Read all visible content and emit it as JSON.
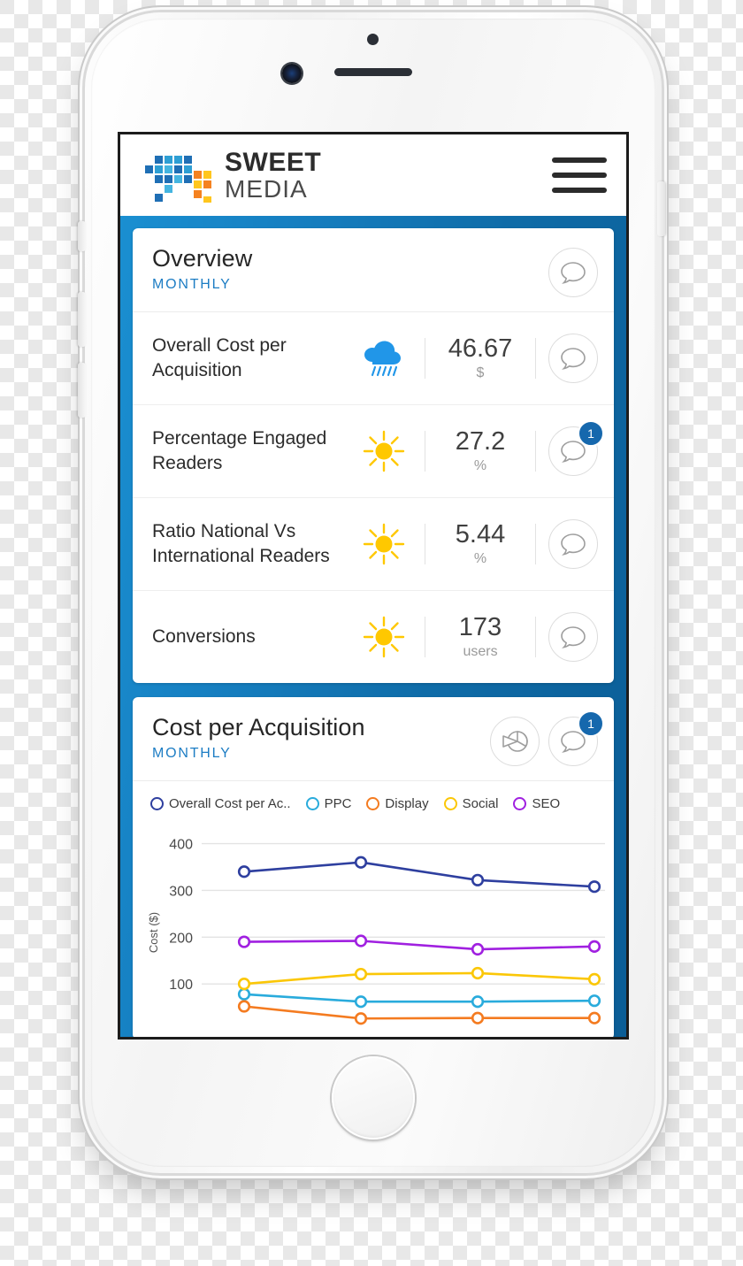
{
  "brand": {
    "name_top": "SWEET",
    "name_bottom": "MEDIA",
    "logo_icon": "pixel-map-logo",
    "menu_icon": "hamburger-menu-icon"
  },
  "overview_card": {
    "title": "Overview",
    "subtitle": "MONTHLY",
    "comment_icon": "speech-bubble-icon",
    "metrics": [
      {
        "label": "Overall Cost per Acquisition",
        "status_icon": "rain-cloud-icon",
        "value": "46.67",
        "unit": "$",
        "comment_icon": "speech-bubble-icon",
        "badge": ""
      },
      {
        "label": "Percentage Engaged Readers",
        "status_icon": "sun-icon",
        "value": "27.2",
        "unit": "%",
        "comment_icon": "speech-bubble-icon",
        "badge": "1"
      },
      {
        "label": "Ratio National Vs International Readers",
        "status_icon": "sun-icon",
        "value": "5.44",
        "unit": "%",
        "comment_icon": "speech-bubble-icon",
        "badge": ""
      },
      {
        "label": "Conversions",
        "status_icon": "sun-icon",
        "value": "173",
        "unit": "users",
        "comment_icon": "speech-bubble-icon",
        "badge": ""
      }
    ]
  },
  "chart_card": {
    "title": "Cost per Acquisition",
    "subtitle": "MONTHLY",
    "drilldown_icon": "pie-arrow-drilldown-icon",
    "comment_icon": "speech-bubble-icon",
    "comment_badge": "1"
  },
  "chart_data": {
    "type": "line",
    "title": "Cost per Acquisition",
    "xlabel": "",
    "ylabel": "Cost ($)",
    "ylim": [
      0,
      420
    ],
    "yticks": [
      100,
      200,
      300,
      400
    ],
    "grid": true,
    "legend_position": "top",
    "x": [
      1,
      2,
      3,
      4
    ],
    "series": [
      {
        "name": "Overall Cost per Ac..",
        "color": "#2E3F9F",
        "values": [
          340,
          360,
          322,
          308
        ]
      },
      {
        "name": "PPC",
        "color": "#29ABDC",
        "values": [
          78,
          62,
          62,
          64
        ]
      },
      {
        "name": "Display",
        "color": "#F47B20",
        "values": [
          52,
          26,
          27,
          27
        ]
      },
      {
        "name": "Social",
        "color": "#FBC707",
        "values": [
          100,
          121,
          123,
          110
        ]
      },
      {
        "name": "SEO",
        "color": "#A020E0",
        "values": [
          190,
          192,
          174,
          180
        ]
      }
    ]
  },
  "colors": {
    "brand_blue": "#1668ad",
    "card_blue_light": "#1a8fd1",
    "card_blue_dark": "#0b5d96",
    "sun_yellow": "#FFC800",
    "cloud_blue": "#2196E8"
  }
}
